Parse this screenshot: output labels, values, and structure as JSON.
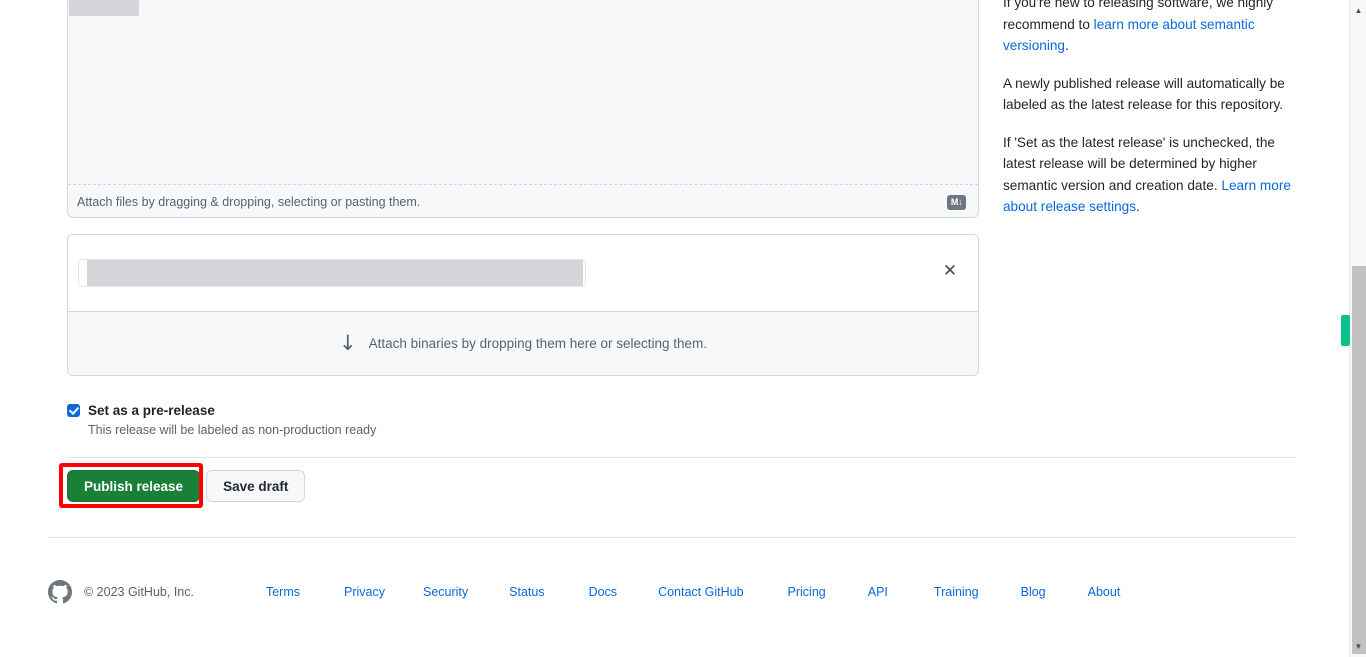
{
  "editor": {
    "attach_files_hint": "Attach files by dragging & dropping, selecting or pasting them.",
    "markdown_badge": "M↓",
    "markdown_icon_name": "markdown-icon"
  },
  "assets": {
    "remove_icon": "✕",
    "dropzone_arrow": "↓",
    "dropzone_text": "Attach binaries by dropping them here or selecting them."
  },
  "prerelease": {
    "label": "Set as a pre-release",
    "description": "This release will be labeled as non-production ready",
    "checked": true,
    "accent_color": "#0969da"
  },
  "actions": {
    "publish_label": "Publish release",
    "save_draft_label": "Save draft",
    "publish_color": "#1a7f37",
    "highlight_color": "#ff0000"
  },
  "sidebar": {
    "p1_prefix": "If you're new to releasing software, we highly recommend to ",
    "p1_link": "learn more about semantic versioning",
    "p1_suffix": ".",
    "p2": "A newly published release will automatically be labeled as the latest release for this repository.",
    "p3_prefix": "If 'Set as the latest release' is unchecked, the latest release will be determined by higher semantic version and creation date. ",
    "p3_link": "Learn more about release settings",
    "p3_suffix": "."
  },
  "footer": {
    "copyright": "© 2023 GitHub, Inc.",
    "logo_name": "github-mark-icon",
    "links": [
      "Terms",
      "Privacy",
      "Security",
      "Status",
      "Docs",
      "Contact GitHub",
      "Pricing",
      "API",
      "Training",
      "Blog",
      "About"
    ]
  },
  "scrollbar": {
    "up_arrow": "▲",
    "down_arrow": "▼",
    "find_marker_color": "#0ac18e"
  }
}
